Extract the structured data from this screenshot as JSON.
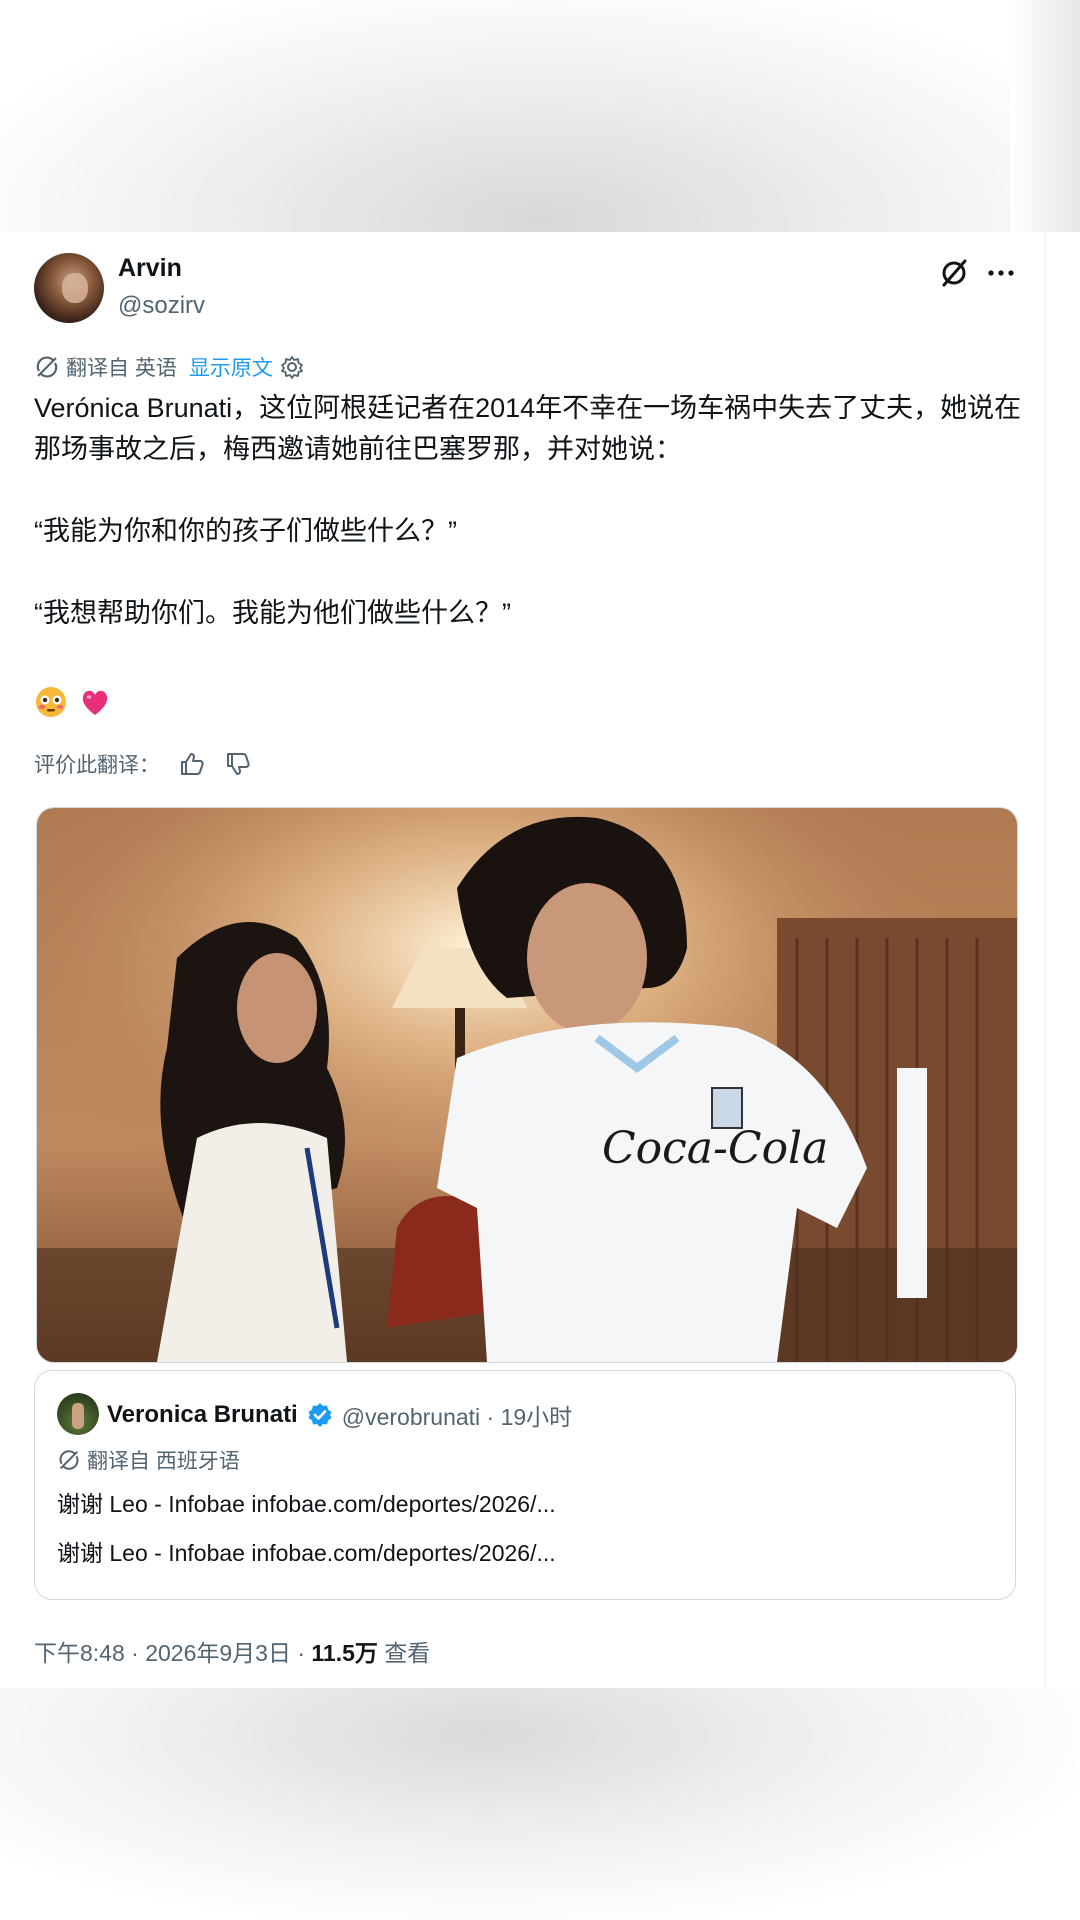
{
  "author": {
    "name": "Arvin",
    "handle": "@sozirv"
  },
  "icons": {
    "grok": "grok-slash-icon",
    "more": "more-dots-icon",
    "translate": "translate-icon",
    "settings": "gear-icon",
    "thumbs_up": "thumbs-up-icon",
    "thumbs_down": "thumbs-down-icon",
    "verified": "verified-badge-icon"
  },
  "translation": {
    "from_label": "翻译自 英语",
    "show_original": "显示原文"
  },
  "post": {
    "line1": "Verónica Brunati，这位阿根廷记者在2014年不幸在一场车祸中失去了丈夫，她说在那场事故之后，梅西邀请她前往巴塞罗那，并对她说：",
    "quote1": "“我能为你和你的孩子们做些什么？”",
    "quote2": "“我想帮助你们。我能为他们做些什么？”",
    "emoji1": "flushed-face-emoji",
    "emoji2": "pink-heart-emoji"
  },
  "rate": {
    "label": "评价此翻译："
  },
  "quoted": {
    "name": "Veronica Brunati",
    "meta": "@verobrunati · 19小时",
    "translated_from": "翻译自 西班牙语",
    "line1": "谢谢 Leo - Infobae infobae.com/deportes/2026/...",
    "line2": "谢谢 Leo - Infobae infobae.com/deportes/2026/..."
  },
  "meta": {
    "time_date": "下午8:48 · 2026年9月3日 · ",
    "views_count": "11.5万",
    "views_label": " 查看"
  },
  "colors": {
    "text": "#0f1419",
    "muted": "#536471",
    "link": "#1d9bf0",
    "border": "#cfd9de"
  }
}
